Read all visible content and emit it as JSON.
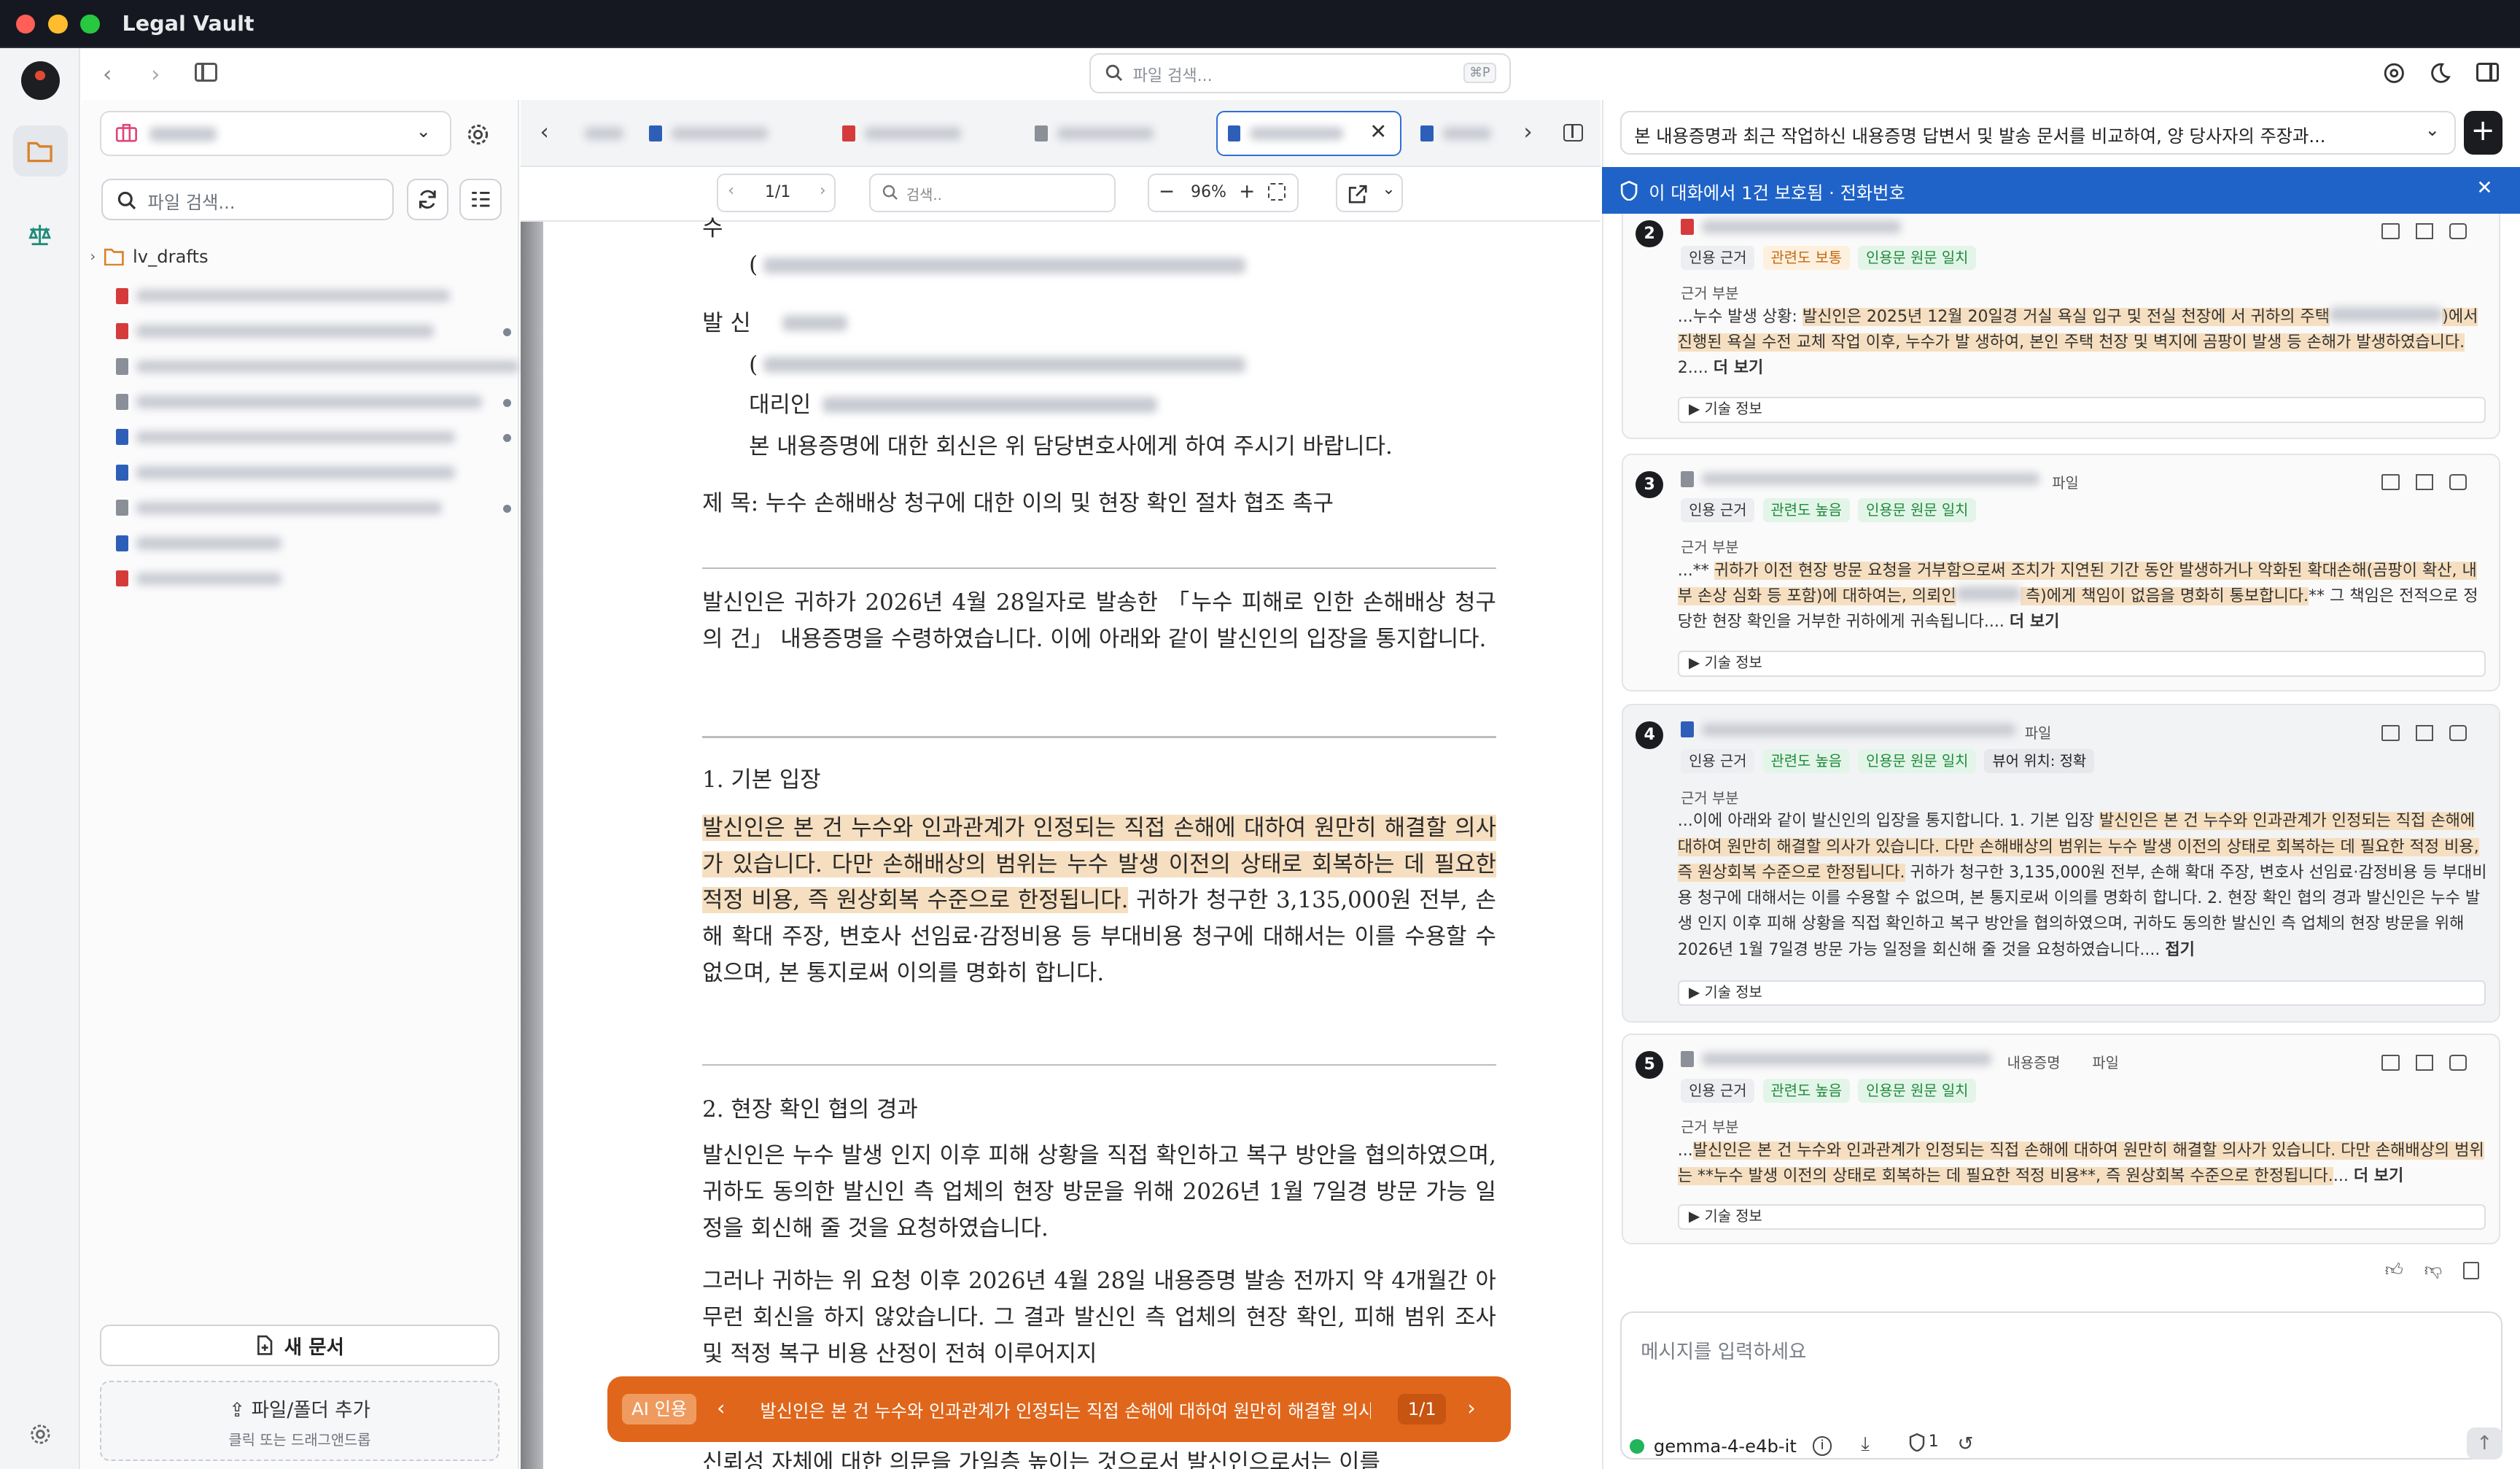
{
  "window": {
    "title": "Legal Vault"
  },
  "search": {
    "placeholder": "파일 검색...",
    "shortcut": "⌘P"
  },
  "sidebar": {
    "search_placeholder": "파일 검색...",
    "folder": "lv_drafts",
    "new_doc_label": "새 문서",
    "add_label": "파일/폴더 추가",
    "drop_hint": "클릭 또는 드래그앤드롭"
  },
  "doc_toolbar": {
    "page": "1/1",
    "search_placeholder": "검색..",
    "zoom": "96%"
  },
  "document": {
    "sender_label": "발  신",
    "agent_label": "대리인",
    "reply_line": "본 내용증명에 대한 회신은 위 담당변호사에게 하여 주시기 바랍니다.",
    "subject": "제  목: 누수 손해배상 청구에 대한 이의 및 현장 확인 절차 협조 촉구",
    "para1": "발신인은 귀하가 2026년 4월 28일자로 발송한 「누수 피해로 인한 손해배상 청구의 건」 내용증명을 수령하였습니다. 이에 아래와 같이 발신인의 입장을 통지합니다.",
    "sec1": "1. 기본 입장",
    "sec1_hl": "발신인은 본 건 누수와 인과관계가 인정되는 직접 손해에 대하여 원만히 해결할 의사가 있습니다. 다만 손해배상의 범위는 누수 발생 이전의 상태로 회복하는 데 필요한 적정 비용, 즉 원상회복 수준으로 한정됩니다.",
    "sec1_rest": " 귀하가 청구한 3,135,000원 전부, 손해 확대 주장, 변호사 선임료·감정비용 등 부대비용 청구에 대해서는 이를 수용할 수 없으며, 본 통지로써 이의를 명화히 합니다.",
    "sec2": "2. 현장 확인 협의 경과",
    "sec2_p1": "발신인은 누수 발생 인지 이후 피해 상황을 직접 확인하고 복구 방안을 협의하였으며, 귀하도 동의한 발신인 측 업체의 현장 방문을 위해 2026년 1월 7일경 방문 가능 일정을 회신해 줄 것을 요청하였습니다.",
    "sec2_p2": "그러나 귀하는 위 요청 이후 2026년 4월 28일 내용증명 발송 전까지 약 4개월간 아무런 회신을 하지 않았습니다. 그 결과 발신인 측 업체의 현장 확인, 피해 범위 조사 및 적정 복구 비용 산정이 전혀 이루어지지",
    "sec2_p3": "신뢰성 자체에 대한 의문을 가일층 높이는 것으로서 발신인으로서는 이를"
  },
  "citation_bar": {
    "tag": "AI 인용",
    "text": "발신인은 본 건 누수와 인과관계가 인정되는 직접 손해에 대하여 원만히 해결할 의사가 있...",
    "count": "1/1"
  },
  "right_panel": {
    "conversation_title": "본 내용증명과 최근 작업하신 내용증명 답변서 및 발송 문서를 비교하여, 양 당사자의 주장과...",
    "banner": "이 대화에서 1건 보호됨 · 전화번호",
    "cards": [
      {
        "num": "2",
        "badges": [
          "인용 근거",
          "관련도 보통",
          "인용문 원문 일치"
        ],
        "section": "근거 부분",
        "pre": "...누수 발생 상황: ",
        "hl": "발신인은 2025년 12월 20일경 거실 욕실 입구 및 전실 천장에 서 귀하의 주택",
        "hl2": ")에서 진행된 욕실 수전 교체 작업 이후, 누수가 발 생하여, 본인 주택 천장 및 벽지에 곰팡이 발생 등 손해가 발생하였습니다.",
        "post": " 2.... ",
        "more": "더 보기",
        "tech": "▶ 기술 정보"
      },
      {
        "num": "3",
        "type": "파일",
        "badges": [
          "인용 근거",
          "관련도 높음",
          "인용문 원문 일치"
        ],
        "section": "근거 부분",
        "pre": "...** ",
        "hl": "귀하가 이전 현장 방문 요청을 거부함으로써 조치가 지연된 기간 동안 발생하거나 악화된 확대손해(곰팡이 확산, 내부 손상 심화 등 포함)에 대하여는, 의뢰인",
        "hl2": " 측)에게 책임이 없음을 명화히 통보합니다.",
        "post": "** 그 책임은 전적으로 정당한 현장 확인을 거부한 귀하에게 귀속됩니다.... ",
        "more": "더 보기",
        "tech": "▶ 기술 정보"
      },
      {
        "num": "4",
        "type": "파일",
        "badges": [
          "인용 근거",
          "관련도 높음",
          "인용문 원문 일치",
          "뷰어 위치: 정확"
        ],
        "section": "근거 부분",
        "pre": "...이에 아래와 같이 발신인의 입장을 통지합니다. 1. 기본 입장 ",
        "hl": "발신인은 본 건 누수와 인과관계가 인정되는 직접 손해에 대하여 원만히 해결할 의사가 있습니다. 다만 손해배상의 범위는 누수 발생 이전의 상태로 회복하는 데 필요한 적정 비용, 즉 원상회복 수준으로 한정됩니다.",
        "post": " 귀하가 청구한 3,135,000원 전부, 손해 확대 주장, 변호사 선임료·감정비용 등 부대비용 청구에 대해서는 이를 수용할 수 없으며, 본 통지로써 이의를 명화히 합니다. 2. 현장 확인 협의 경과 발신인은 누수 발생 인지 이후 피해 상황을 직접 확인하고 복구 방안을 협의하였으며, 귀하도 동의한 발신인 측 업체의 현장 방문을 위해 2026년 1월 7일경 방문 가능 일정을 회신해 줄 것을 요청하였습니다.... ",
        "more": "접기",
        "tech": "▶ 기술 정보"
      },
      {
        "num": "5",
        "type": "파일",
        "doc_type": "내용증명",
        "badges": [
          "인용 근거",
          "관련도 높음",
          "인용문 원문 일치"
        ],
        "section": "근거 부분",
        "pre": "...",
        "hl": "발신인은 본 건 누수와 인과관계가 인정되는 직접 손해에 대하여 원만히 해결할 의사가 있습니다. 다만 손해배상의 범위는 **누수 발생 이전의 상태로 회복하는 데 필요한 적정 비용**, 즉 원상회복 수준으로 한정됩니다.",
        "post": "... ",
        "more": "더 보기",
        "tech": "▶ 기술 정보"
      }
    ],
    "compose_placeholder": "메시지를 입력하세요",
    "model": "gemma-4-e4b-it",
    "protected_count": "1"
  }
}
